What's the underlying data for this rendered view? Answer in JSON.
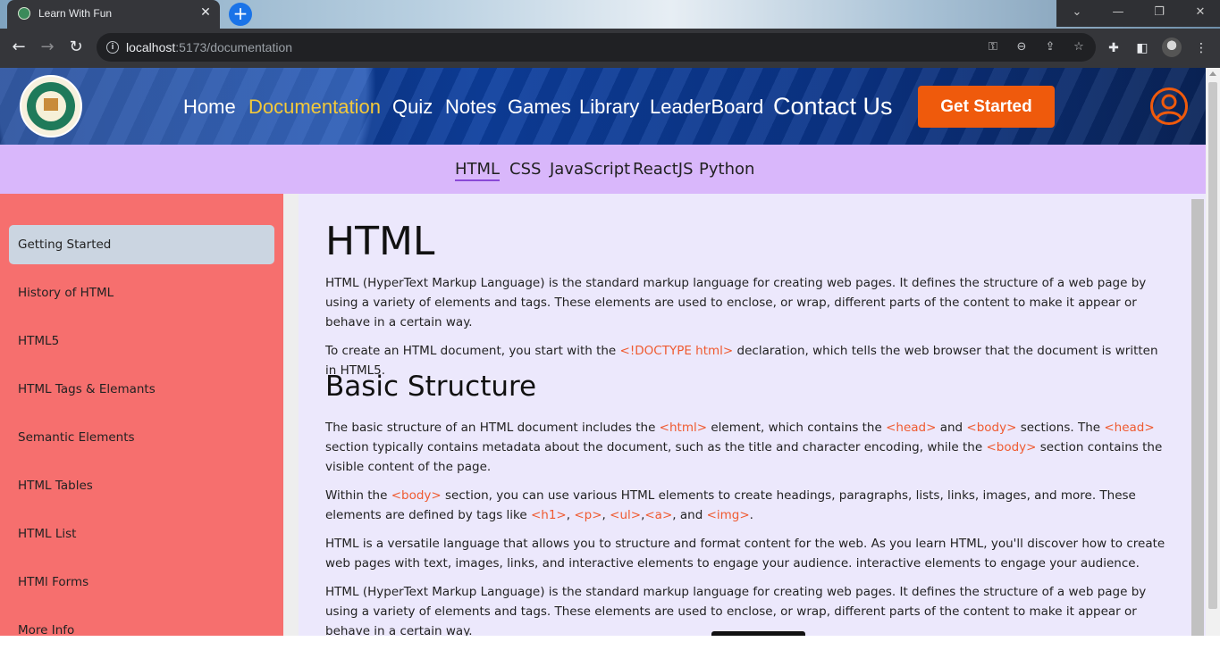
{
  "browser": {
    "tab_title": "Learn With Fun",
    "new_tab_symbol": "+",
    "url_host": "localhost",
    "url_rest": ":5173/documentation",
    "window_controls": [
      "⌄",
      "—",
      "❐",
      "✕"
    ]
  },
  "header": {
    "nav": [
      "Home",
      "Documentation",
      "Quiz",
      "Notes",
      "Games",
      "Library",
      "LeaderBoard",
      "Contact Us"
    ],
    "active_nav": "Documentation",
    "cta_label": "Get Started",
    "accent_color": "#ef5a0c",
    "active_color": "#f3c93a"
  },
  "languages": [
    "HTML",
    "CSS",
    "JavaScript",
    "ReactJS",
    "Python"
  ],
  "active_language": "HTML",
  "sidebar": {
    "items": [
      "Getting Started",
      "History of HTML",
      "HTML5",
      "HTML Tags & Elemants",
      "Semantic Elements",
      "HTML Tables",
      "HTML List",
      "HTMl Forms",
      "More Info"
    ],
    "active": "Getting Started"
  },
  "content": {
    "title": "HTML",
    "intro": "HTML (HyperText Markup Language) is the standard markup language for creating web pages. It defines the structure of a web page by using a variety of elements and tags. These elements are used to enclose, or wrap, different parts of the content to make it appear or behave in a certain way.",
    "doctype_before": "To create an HTML document, you start with the ",
    "doctype_code": "<!DOCTYPE html>",
    "doctype_after": " declaration, which tells the web browser that the document is written in HTML5.",
    "structure_heading": "Basic Structure",
    "structure": {
      "t1": "The basic structure of an HTML document includes the ",
      "c1": "<html>",
      "t2": " element, which contains the ",
      "c2": "<head>",
      "t3": " and ",
      "c3": "<body>",
      "t4": " sections. The ",
      "c4": "<head>",
      "t5": " section typically contains metadata about the document, such as the title and character encoding, while the ",
      "c5": "<body>",
      "t6": " section contains the visible content of the page."
    },
    "within": {
      "t1": "Within the ",
      "c1": "<body>",
      "t2": " section, you can use various HTML elements to create headings, paragraphs, lists, links, images, and more. These elements are defined by tags like ",
      "c2": "<h1>",
      "t3": ", ",
      "c3": "<p>",
      "t4": ", ",
      "c4": "<ul>",
      "t5": ",",
      "c5": "<a>",
      "t6": ", and ",
      "c6": "<img>",
      "t7": "."
    },
    "versatile": "HTML is a versatile language that allows you to structure and format content for the web. As you learn HTML, you'll discover how to create web pages with text, images, links, and interactive elements to engage your audience. interactive elements to engage your audience.",
    "intro_repeat": "HTML (HyperText Markup Language) is the standard markup language for creating web pages. It defines the structure of a web page by using a variety of elements and tags. These elements are used to enclose, or wrap, different parts of the content to make it appear or behave in a certain way."
  }
}
